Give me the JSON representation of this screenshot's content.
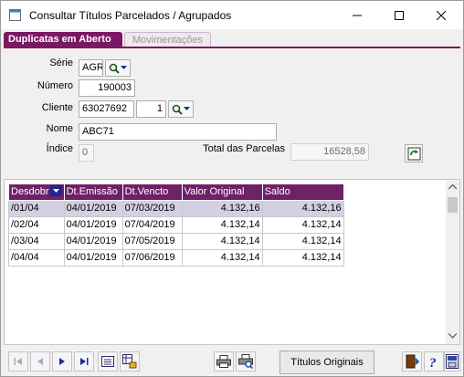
{
  "window": {
    "title": "Consultar Títulos Parcelados / Agrupados"
  },
  "tabs": [
    {
      "label": "Duplicatas em Aberto",
      "active": true
    },
    {
      "label": "Movimentações",
      "active": false
    }
  ],
  "form": {
    "serie": {
      "label": "Série",
      "value": "AGR"
    },
    "numero": {
      "label": "Número",
      "value": "190003"
    },
    "cliente": {
      "label": "Cliente",
      "code": "63027692",
      "seq": "1"
    },
    "nome": {
      "label": "Nome",
      "value": "ABC71"
    },
    "indice": {
      "label": "Índice",
      "value": "0"
    },
    "total_parcelas": {
      "label": "Total das Parcelas",
      "value": "16528,58"
    }
  },
  "grid": {
    "columns": [
      "Desdobr",
      "Dt.Emissão",
      "Dt.Vencto",
      "Valor Original",
      "Saldo"
    ],
    "rows": [
      [
        "/01/04",
        "04/01/2019",
        "07/03/2019",
        "4.132,16",
        "4.132,16"
      ],
      [
        "/02/04",
        "04/01/2019",
        "07/04/2019",
        "4.132,14",
        "4.132,14"
      ],
      [
        "/03/04",
        "04/01/2019",
        "07/05/2019",
        "4.132,14",
        "4.132,14"
      ],
      [
        "/04/04",
        "04/01/2019",
        "07/06/2019",
        "4.132,14",
        "4.132,14"
      ]
    ],
    "selected_row": 0
  },
  "toolbar": {
    "titulos_originais": "Títulos Originais"
  },
  "colors": {
    "tab_active": "#7a1863",
    "header": "#6f2167",
    "selected_row": "#d3d0e3"
  }
}
